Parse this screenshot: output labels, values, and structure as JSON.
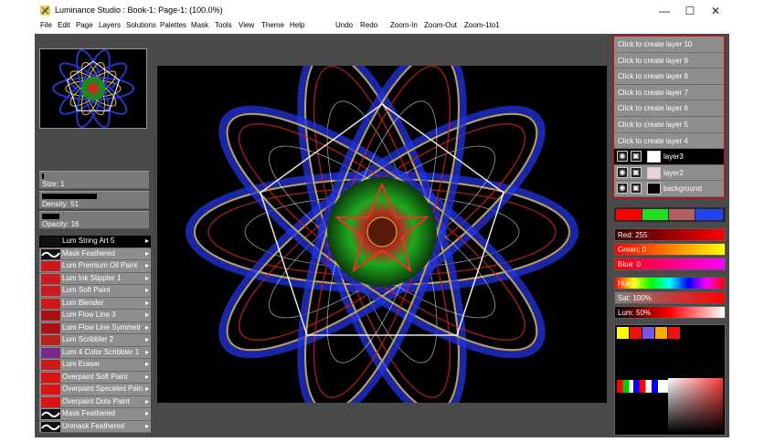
{
  "window": {
    "title": "Luminance Studio : Book-1: Page-1:  (100.0%)",
    "controls": {
      "minimize": "—",
      "maximize": "☐",
      "close": "✕"
    }
  },
  "menu": [
    "File",
    "Edit",
    "Page",
    "Layers",
    "Solutions",
    "Palettes",
    "Mask",
    "Tools",
    "View",
    "Theme",
    "Help",
    "Undo",
    "Redo",
    "Zoom-In",
    "Zoom-Out",
    "Zoom-1to1"
  ],
  "properties": {
    "size": "Size: 1",
    "density": "Density: 51",
    "opacity": "Opacity: 16"
  },
  "brushes": [
    {
      "label": "Lum String Art 5",
      "arrow": "▸",
      "selected": true
    },
    {
      "label": "Mask Feathered",
      "arrow": "▸"
    },
    {
      "label": "Lum Premium Oil Paint",
      "arrow": "▸"
    },
    {
      "label": "Lum Ink Stippler 1",
      "arrow": "▸"
    },
    {
      "label": "Lum Soft Paint",
      "arrow": "▸"
    },
    {
      "label": "Lum Blender",
      "arrow": "▸"
    },
    {
      "label": "Lum Flow Line 3",
      "arrow": "▸"
    },
    {
      "label": "Lum Flow Line Symmetr",
      "arrow": "▸"
    },
    {
      "label": "Lum Scribbler 2",
      "arrow": "▸"
    },
    {
      "label": "Lum 4 Color Scribbler 1",
      "arrow": "▸"
    },
    {
      "label": "Lum Eraser",
      "arrow": "▸"
    },
    {
      "label": "Overpaint Soft Paint",
      "arrow": "▸"
    },
    {
      "label": "Overpaint Speckled Pain",
      "arrow": "▸"
    },
    {
      "label": "Overpaint Dots Paint",
      "arrow": "▸"
    },
    {
      "label": "Mask Feathered",
      "arrow": "▸"
    },
    {
      "label": "Unmask Feathered",
      "arrow": "▸"
    }
  ],
  "layers": {
    "empty": [
      "Click to create layer 10",
      "Click to create layer 9",
      "Click to create layer 8",
      "Click to create layer 7",
      "Click to create layer 6",
      "Click to create layer 5",
      "Click to create layer 4"
    ],
    "real": [
      {
        "name": "layer3",
        "active": true
      },
      {
        "name": "layer2",
        "active": false
      },
      {
        "name": "background",
        "active": false
      }
    ]
  },
  "color": {
    "red": "Red: 255",
    "green": "Green: 0",
    "blue": "Blue: 0",
    "hue": "Hue: 0",
    "sat": "Sat: 100%",
    "lum": "Lum: 50%",
    "swatches": [
      "#ff0000",
      "#22dd22",
      "#b06060",
      "#2244ee"
    ],
    "palette_top": [
      "#ffff00",
      "#ee1111",
      "#7755ee",
      "#ffaa00",
      "#ee1111"
    ],
    "accent": "#a02020"
  }
}
